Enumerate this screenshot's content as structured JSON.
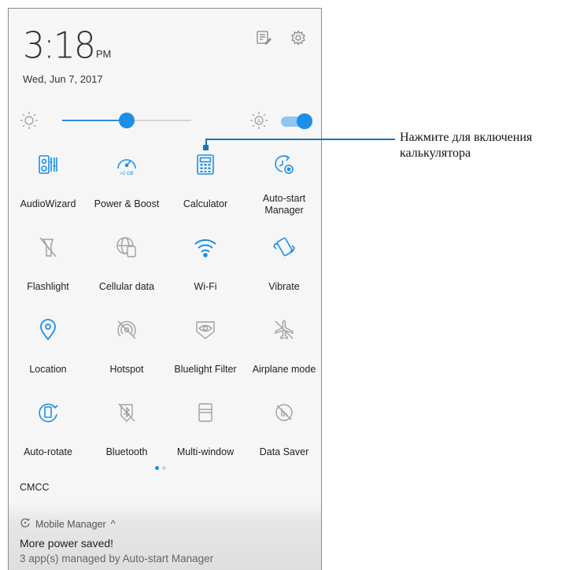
{
  "status": {
    "time": "3:18",
    "ampm": "PM",
    "date": "Wed, Jun 7, 2017"
  },
  "top_icons": [
    "edit-notes-icon",
    "gear-icon"
  ],
  "brightness": {
    "level": 0.5,
    "auto": true
  },
  "tiles": [
    {
      "label": "AudioWizard",
      "icon": "audiowizard-icon",
      "active": true
    },
    {
      "label": "Power & Boost",
      "icon": "power-boost-icon",
      "active": true,
      "badge": ">2 GB"
    },
    {
      "label": "Calculator",
      "icon": "calculator-icon",
      "active": true
    },
    {
      "label": "Auto-start Manager",
      "icon": "auto-start-icon",
      "active": true
    },
    {
      "label": "Flashlight",
      "icon": "flashlight-icon",
      "active": false
    },
    {
      "label": "Cellular data",
      "icon": "cellular-data-icon",
      "active": false
    },
    {
      "label": "Wi-Fi",
      "icon": "wifi-icon",
      "active": true
    },
    {
      "label": "Vibrate",
      "icon": "vibrate-icon",
      "active": true
    },
    {
      "label": "Location",
      "icon": "location-icon",
      "active": true
    },
    {
      "label": "Hotspot",
      "icon": "hotspot-icon",
      "active": false
    },
    {
      "label": "Bluelight Filter",
      "icon": "bluelight-filter-icon",
      "active": false
    },
    {
      "label": "Airplane mode",
      "icon": "airplane-icon",
      "active": false
    },
    {
      "label": "Auto-rotate",
      "icon": "auto-rotate-icon",
      "active": true
    },
    {
      "label": "Bluetooth",
      "icon": "bluetooth-icon",
      "active": false
    },
    {
      "label": "Multi-window",
      "icon": "multi-window-icon",
      "active": false
    },
    {
      "label": "Data Saver",
      "icon": "data-saver-icon",
      "active": false
    }
  ],
  "page_dots": 2,
  "carrier": "CMCC",
  "notification": {
    "app": "Mobile Manager",
    "caret": "^",
    "title": "More power saved!",
    "text": "3 app(s) managed by Auto-start Manager"
  },
  "callout": {
    "line1": "Нажмите для включения",
    "line2": "калькулятора"
  },
  "colors": {
    "active": "#1b8fe8",
    "inactive": "#a0a0a0",
    "callout": "#1a75b5"
  }
}
